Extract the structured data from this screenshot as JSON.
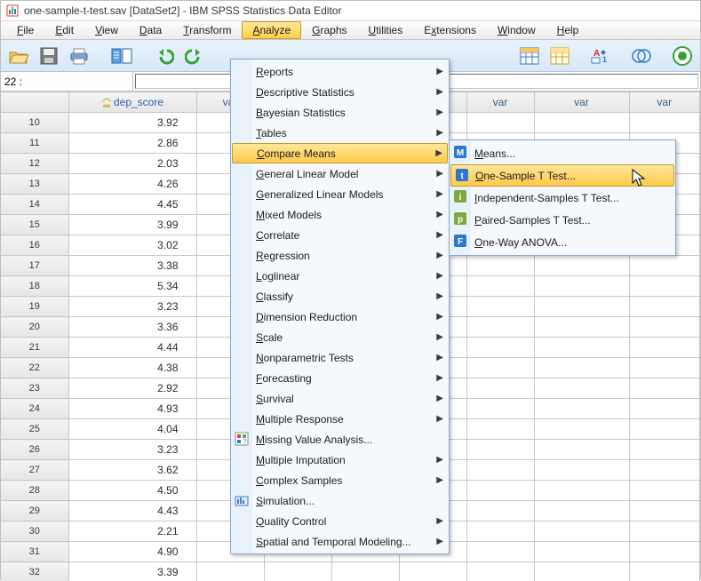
{
  "title": "one-sample-t-test.sav [DataSet2] - IBM SPSS Statistics Data Editor",
  "menubar": {
    "file": "File",
    "edit": "Edit",
    "view": "View",
    "data": "Data",
    "transform": "Transform",
    "analyze": "Analyze",
    "graphs": "Graphs",
    "utilities": "Utilities",
    "extensions": "Extensions",
    "window": "Window",
    "help": "Help"
  },
  "infobar": {
    "label": "22 :",
    "value": ""
  },
  "grid": {
    "corner": "",
    "columns": [
      "dep_score",
      "var",
      "var",
      "var",
      "var",
      "var",
      "var",
      "var"
    ],
    "first_row_num": 10,
    "rows": [
      {
        "n": 10,
        "v": "3.92"
      },
      {
        "n": 11,
        "v": "2.86"
      },
      {
        "n": 12,
        "v": "2.03"
      },
      {
        "n": 13,
        "v": "4.26"
      },
      {
        "n": 14,
        "v": "4.45"
      },
      {
        "n": 15,
        "v": "3.99"
      },
      {
        "n": 16,
        "v": "3.02"
      },
      {
        "n": 17,
        "v": "3.38"
      },
      {
        "n": 18,
        "v": "5.34"
      },
      {
        "n": 19,
        "v": "3.23"
      },
      {
        "n": 20,
        "v": "3.36"
      },
      {
        "n": 21,
        "v": "4.44"
      },
      {
        "n": 22,
        "v": "4.38"
      },
      {
        "n": 23,
        "v": "2.92"
      },
      {
        "n": 24,
        "v": "4.93"
      },
      {
        "n": 25,
        "v": "4.04"
      },
      {
        "n": 26,
        "v": "3.23"
      },
      {
        "n": 27,
        "v": "3.62"
      },
      {
        "n": 28,
        "v": "4.50"
      },
      {
        "n": 29,
        "v": "4.43"
      },
      {
        "n": 30,
        "v": "2.21"
      },
      {
        "n": 31,
        "v": "4.90"
      },
      {
        "n": 32,
        "v": "3.39"
      }
    ]
  },
  "analyze_menu": [
    {
      "label": "Reports",
      "sub": true
    },
    {
      "label": "Descriptive Statistics",
      "sub": true
    },
    {
      "label": "Bayesian Statistics",
      "sub": true
    },
    {
      "label": "Tables",
      "sub": true
    },
    {
      "label": "Compare Means",
      "sub": true,
      "highlight": true
    },
    {
      "label": "General Linear Model",
      "sub": true
    },
    {
      "label": "Generalized Linear Models",
      "sub": true
    },
    {
      "label": "Mixed Models",
      "sub": true
    },
    {
      "label": "Correlate",
      "sub": true
    },
    {
      "label": "Regression",
      "sub": true
    },
    {
      "label": "Loglinear",
      "sub": true
    },
    {
      "label": "Classify",
      "sub": true
    },
    {
      "label": "Dimension Reduction",
      "sub": true
    },
    {
      "label": "Scale",
      "sub": true
    },
    {
      "label": "Nonparametric Tests",
      "sub": true
    },
    {
      "label": "Forecasting",
      "sub": true
    },
    {
      "label": "Survival",
      "sub": true
    },
    {
      "label": "Multiple Response",
      "sub": true
    },
    {
      "label": "Missing Value Analysis...",
      "sub": false,
      "icon": "mva"
    },
    {
      "label": "Multiple Imputation",
      "sub": true
    },
    {
      "label": "Complex Samples",
      "sub": true
    },
    {
      "label": "Simulation...",
      "sub": false,
      "icon": "sim"
    },
    {
      "label": "Quality Control",
      "sub": true
    },
    {
      "label": "Spatial and Temporal Modeling...",
      "sub": true
    }
  ],
  "compare_means_submenu": [
    {
      "label": "Means...",
      "icon": "M",
      "color": "#2a78d0"
    },
    {
      "label": "One-Sample T Test...",
      "icon": "t",
      "color": "#2a78d0",
      "highlight": true
    },
    {
      "label": "Independent-Samples T Test...",
      "icon": "it",
      "color": "#7fa940"
    },
    {
      "label": "Paired-Samples T Test...",
      "icon": "pt",
      "color": "#7fa940"
    },
    {
      "label": "One-Way ANOVA...",
      "icon": "F",
      "color": "#2a78d0"
    }
  ],
  "toolbar_icons": [
    "open",
    "save",
    "print",
    "recall",
    "undo",
    "redo",
    "goto",
    "find",
    "insert",
    "split",
    "weight",
    "select",
    "value-labels",
    "sets",
    "add"
  ]
}
